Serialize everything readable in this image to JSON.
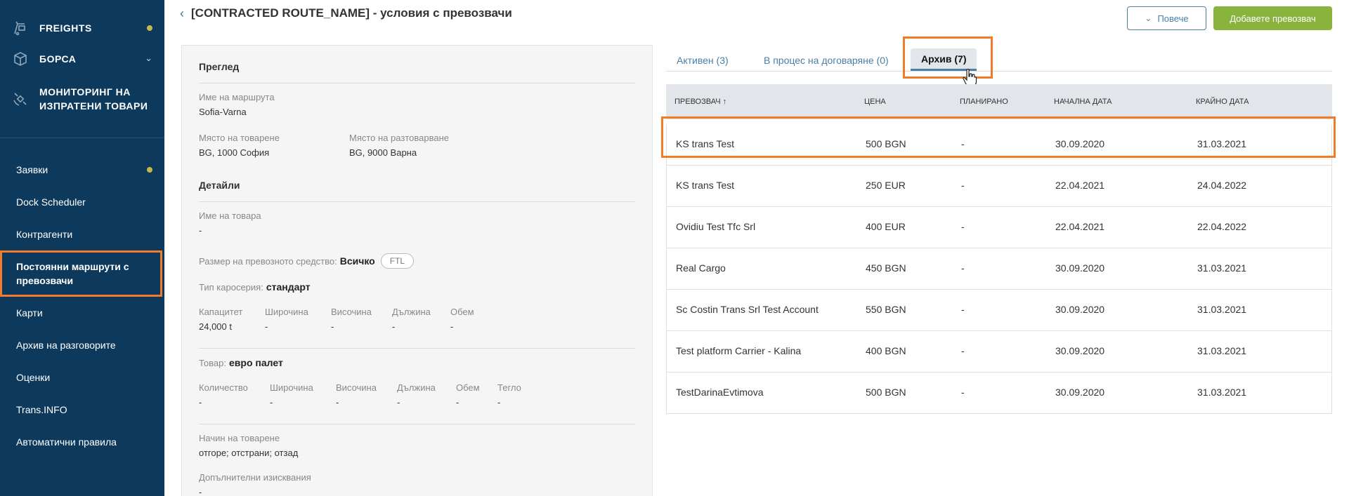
{
  "sidebar": {
    "main_items": [
      {
        "label": "FREIGHTS",
        "icon": "freights-icon"
      },
      {
        "label": "БОРСА",
        "icon": "box-icon"
      },
      {
        "label_line1": "МОНИТОРИНГ НА",
        "label_line2": "ИЗПРАТЕНИ ТОВАРИ",
        "icon": "satellite-icon"
      }
    ],
    "sub_items": [
      {
        "label": "Заявки"
      },
      {
        "label": "Dock Scheduler"
      },
      {
        "label": "Контрагенти"
      },
      {
        "label_line1": "Постоянни маршрути с",
        "label_line2": "превозвачи"
      },
      {
        "label": "Карти"
      },
      {
        "label": "Архив на разговорите"
      },
      {
        "label": "Оценки"
      },
      {
        "label": "Trans.INFO"
      },
      {
        "label": "Автоматични правила"
      }
    ]
  },
  "header": {
    "title": "[CONTRACTED ROUTE_NAME] - условия с превозвачи",
    "more_label": "Повече",
    "add_label": "Добавете превозвач"
  },
  "overview": {
    "title": "Преглед",
    "route_name_label": "Име на маршрута",
    "route_name": "Sofia-Varna",
    "loading_label": "Място на товарене",
    "loading_value": "BG, 1000 София",
    "unloading_label": "Място на разтоварване",
    "unloading_value": "BG, 9000 Варна"
  },
  "details": {
    "title": "Детайли",
    "goods_name_label": "Име на товара",
    "goods_name": "-",
    "vehicle_size_label": "Размер на превозното средство:",
    "vehicle_size_value": "Всичко",
    "vehicle_tag": "FTL",
    "body_type_label": "Тип каросерия:",
    "body_type_value": "стандарт",
    "cap_headers": [
      "Капацитет",
      "Широчина",
      "Височина",
      "Дължина",
      "Обем"
    ],
    "cap_values": [
      "24,000 t",
      "-",
      "-",
      "-",
      "-"
    ],
    "cargo_label": "Товар:",
    "cargo_value": "евро палет",
    "cargo_headers": [
      "Количество",
      "Широчина",
      "Височина",
      "Дължина",
      "Обем",
      "Тегло"
    ],
    "cargo_values": [
      "-",
      "-",
      "-",
      "-",
      "-",
      "-"
    ],
    "loading_method_label": "Начин на товарене",
    "loading_method_value": "отгоре; отстрани; отзад",
    "extra_label": "Допълнителни изисквания",
    "extra_value": "-"
  },
  "tabs": [
    {
      "label": "Активен (3)"
    },
    {
      "label": "В процес на договаряне (0)"
    },
    {
      "label": "Архив (7)"
    }
  ],
  "table": {
    "headers": [
      "ПРЕВОЗВАЧ ↑",
      "ЦЕНА",
      "ПЛАНИРАНО",
      "НАЧАЛНА ДАТА",
      "КРАЙНО ДАТА"
    ],
    "rows": [
      [
        "KS trans Test",
        "500 BGN",
        "-",
        "30.09.2020",
        "31.03.2021"
      ],
      [
        "KS trans Test",
        "250 EUR",
        "-",
        "22.04.2021",
        "24.04.2022"
      ],
      [
        "Ovidiu Test Tfc Srl",
        "400 EUR",
        "-",
        "22.04.2021",
        "22.04.2022"
      ],
      [
        "Real Cargo",
        "450 BGN",
        "-",
        "30.09.2020",
        "31.03.2021"
      ],
      [
        "Sc Costin Trans Srl Test Account",
        "550 BGN",
        "-",
        "30.09.2020",
        "31.03.2021"
      ],
      [
        "Test platform Carrier - Kalina",
        "400 BGN",
        "-",
        "30.09.2020",
        "31.03.2021"
      ],
      [
        "TestDarinaEvtimova",
        "500 BGN",
        "-",
        "30.09.2020",
        "31.03.2021"
      ]
    ]
  },
  "colors": {
    "sidebar_bg": "#0d3a5c",
    "highlight": "#f07c2a",
    "accent_green": "#88b33d",
    "accent_blue": "#4a7fa6"
  }
}
